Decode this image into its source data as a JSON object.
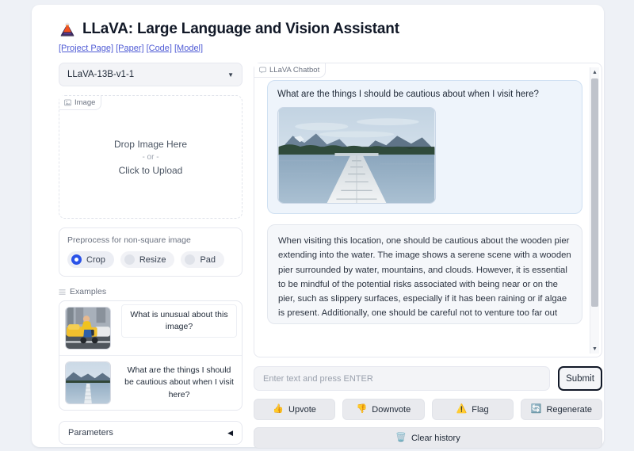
{
  "header": {
    "title": "LLaVA: Large Language and Vision Assistant",
    "logo_icon": "volcano-icon",
    "links": [
      {
        "label": "[Project Page]"
      },
      {
        "label": "[Paper]"
      },
      {
        "label": "[Code]"
      },
      {
        "label": "[Model]"
      }
    ]
  },
  "sidebar": {
    "model_dropdown": {
      "value": "LLaVA-13B-v1-1",
      "caret_icon": "chevron-down-icon"
    },
    "image_block": {
      "label": "Image",
      "label_icon": "image-icon",
      "drop_text": "Drop Image Here",
      "or_text": "- or -",
      "upload_text": "Click to Upload"
    },
    "preprocess": {
      "title": "Preprocess for non-square image",
      "options": [
        {
          "label": "Crop",
          "selected": true
        },
        {
          "label": "Resize",
          "selected": false
        },
        {
          "label": "Pad",
          "selected": false
        }
      ]
    },
    "examples": {
      "label": "Examples",
      "label_icon": "list-icon",
      "rows": [
        {
          "thumb": "ironing-taxi-photo",
          "text": "What is unusual about this image?"
        },
        {
          "thumb": "lake-pier-photo",
          "text": "What are the things I should be cautious about when I visit here?"
        }
      ]
    },
    "parameters": {
      "label": "Parameters",
      "toggle_icon": "triangle-left-icon",
      "collapsed": true
    }
  },
  "chat": {
    "panel_label": "LLaVA Chatbot",
    "panel_label_icon": "chat-icon",
    "user_message": "What are the things I should be cautious about when I visit here?",
    "user_image": "lake-pier-photo",
    "assistant_message": "When visiting this location, one should be cautious about the wooden pier extending into the water. The image shows a serene scene with a wooden pier surrounded by water, mountains, and clouds. However, it is essential to be mindful of the potential risks associated with being near or on the pier, such as slippery surfaces, especially if it has been raining or if algae is present. Additionally, one should be careful not to venture too far out onto the pier, as the water depth or structural integrity of the pier might be unknown. It is also important to be aware of any local wildlife or water hazards, such as",
    "scrollbar": {
      "up_icon": "caret-up-icon",
      "down_icon": "caret-down-icon"
    },
    "input": {
      "placeholder": "Enter text and press ENTER",
      "value": ""
    },
    "submit_label": "Submit",
    "actions": [
      {
        "label": "Upvote",
        "icon": "thumbs-up-icon",
        "glyph": "👍"
      },
      {
        "label": "Downvote",
        "icon": "thumbs-down-icon",
        "glyph": "👎"
      },
      {
        "label": "Flag",
        "icon": "warning-icon",
        "glyph": "⚠️"
      },
      {
        "label": "Regenerate",
        "icon": "refresh-icon",
        "glyph": "🔄"
      }
    ],
    "clear": {
      "label": "Clear history",
      "icon": "trash-icon",
      "glyph": "🗑️"
    }
  },
  "colors": {
    "page_bg": "#eef1f6",
    "card_bg": "#ffffff",
    "link": "#4f5bd5",
    "radio_accent": "#2a52e8",
    "user_bubble": "#eef4fb",
    "bot_bubble": "#f5f7fa",
    "button_bg": "#e9eaee"
  }
}
